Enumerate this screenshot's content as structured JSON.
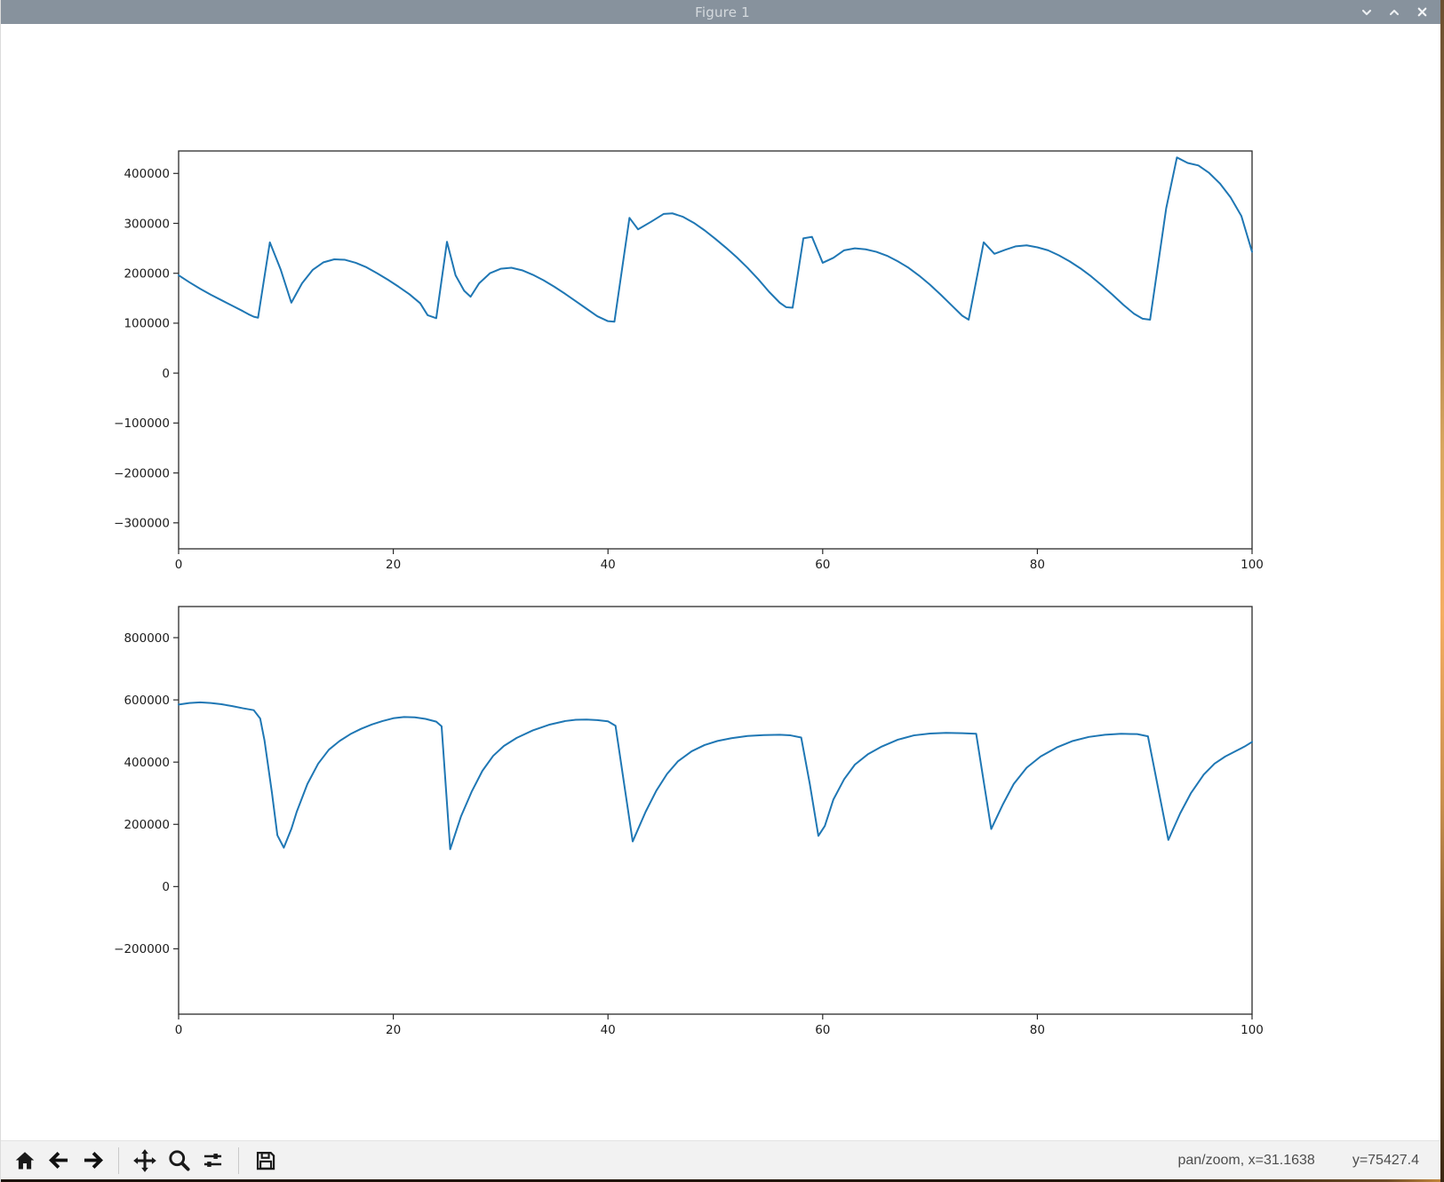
{
  "window": {
    "title": "Figure 1",
    "titlebar_color": "#87929d",
    "accent_color": "#f5ad62"
  },
  "titlebar_controls": {
    "minimize_icon": "chevron-down",
    "maximize_icon": "chevron-up",
    "close_icon": "x"
  },
  "toolbar": {
    "buttons": [
      {
        "icon": "home"
      },
      {
        "icon": "back-arrow"
      },
      {
        "icon": "forward-arrow"
      },
      {
        "icon": "pan-move"
      },
      {
        "icon": "zoom-magnifier"
      },
      {
        "icon": "subplot-sliders"
      },
      {
        "icon": "save-floppy"
      }
    ],
    "status_left": "pan/zoom, x=31.1638",
    "status_right": "y=75427.4"
  },
  "chart_data": [
    {
      "type": "line",
      "color": "#1f77b4",
      "line_width": 2,
      "axis_color": "#2b2b2b",
      "grid": false,
      "legend": null,
      "xlim": [
        0,
        100
      ],
      "ylim": [
        -352000,
        445000
      ],
      "xticks": {
        "values": [
          0,
          20,
          40,
          60,
          80,
          100
        ],
        "labels": [
          "0",
          "20",
          "40",
          "60",
          "80",
          "100"
        ]
      },
      "yticks": {
        "values": [
          400000,
          300000,
          200000,
          100000,
          0,
          -100000,
          -200000,
          -300000
        ],
        "labels": [
          "400000",
          "300000",
          "200000",
          "100000",
          "0",
          "−100000",
          "−200000",
          "−300000"
        ]
      },
      "points": [
        [
          0,
          196000
        ],
        [
          1,
          182000
        ],
        [
          2,
          169000
        ],
        [
          3,
          157000
        ],
        [
          4,
          146000
        ],
        [
          5,
          135000
        ],
        [
          6,
          124000
        ],
        [
          6.5,
          118000
        ],
        [
          7,
          113000
        ],
        [
          7.4,
          111000
        ],
        [
          8.5,
          262000
        ],
        [
          9.5,
          208000
        ],
        [
          10.5,
          141000
        ],
        [
          11.5,
          180000
        ],
        [
          12.5,
          207000
        ],
        [
          13.5,
          222000
        ],
        [
          14.5,
          228000
        ],
        [
          15.5,
          227000
        ],
        [
          16.5,
          221000
        ],
        [
          17.5,
          212000
        ],
        [
          18.5,
          200000
        ],
        [
          19.5,
          187000
        ],
        [
          20.5,
          173000
        ],
        [
          21.5,
          158000
        ],
        [
          22.5,
          140000
        ],
        [
          23.2,
          116000
        ],
        [
          24,
          110000
        ],
        [
          25,
          263000
        ],
        [
          25.8,
          196000
        ],
        [
          26.6,
          165000
        ],
        [
          27.2,
          153000
        ],
        [
          28,
          180000
        ],
        [
          29,
          200000
        ],
        [
          30,
          209000
        ],
        [
          31,
          211000
        ],
        [
          32,
          206000
        ],
        [
          33,
          197000
        ],
        [
          34,
          186000
        ],
        [
          35,
          173000
        ],
        [
          36,
          159000
        ],
        [
          37,
          144000
        ],
        [
          38,
          129000
        ],
        [
          39,
          114000
        ],
        [
          40,
          104000
        ],
        [
          40.6,
          103000
        ],
        [
          42,
          311000
        ],
        [
          42.8,
          288000
        ],
        [
          44,
          303000
        ],
        [
          45.2,
          319000
        ],
        [
          46,
          320000
        ],
        [
          47,
          313000
        ],
        [
          48,
          301000
        ],
        [
          49,
          286000
        ],
        [
          50,
          269000
        ],
        [
          51,
          251000
        ],
        [
          52,
          232000
        ],
        [
          53,
          211000
        ],
        [
          54,
          188000
        ],
        [
          55,
          163000
        ],
        [
          56,
          141000
        ],
        [
          56.6,
          132000
        ],
        [
          57.2,
          131000
        ],
        [
          58.2,
          270000
        ],
        [
          59,
          273000
        ],
        [
          60,
          221000
        ],
        [
          61,
          231000
        ],
        [
          62,
          246000
        ],
        [
          63,
          250000
        ],
        [
          64,
          248000
        ],
        [
          65,
          243000
        ],
        [
          66,
          235000
        ],
        [
          67,
          224000
        ],
        [
          68,
          211000
        ],
        [
          69,
          195000
        ],
        [
          70,
          177000
        ],
        [
          71,
          157000
        ],
        [
          72,
          136000
        ],
        [
          73,
          115000
        ],
        [
          73.6,
          107000
        ],
        [
          75,
          262000
        ],
        [
          76,
          239000
        ],
        [
          77,
          247000
        ],
        [
          78,
          254000
        ],
        [
          79,
          256000
        ],
        [
          80,
          252000
        ],
        [
          81,
          246000
        ],
        [
          82,
          236000
        ],
        [
          83,
          224000
        ],
        [
          84,
          210000
        ],
        [
          85,
          194000
        ],
        [
          86,
          176000
        ],
        [
          87,
          157000
        ],
        [
          88,
          137000
        ],
        [
          89,
          119000
        ],
        [
          89.8,
          109000
        ],
        [
          90.5,
          107000
        ],
        [
          92,
          330000
        ],
        [
          93,
          432000
        ],
        [
          94,
          421000
        ],
        [
          95,
          416000
        ],
        [
          96,
          401000
        ],
        [
          97,
          380000
        ],
        [
          98,
          352000
        ],
        [
          99,
          315000
        ],
        [
          100,
          243000
        ]
      ]
    },
    {
      "type": "line",
      "color": "#1f77b4",
      "line_width": 2,
      "axis_color": "#2b2b2b",
      "grid": false,
      "legend": null,
      "xlim": [
        0,
        100
      ],
      "ylim": [
        -410000,
        900000
      ],
      "xticks": {
        "values": [
          0,
          20,
          40,
          60,
          80,
          100
        ],
        "labels": [
          "0",
          "20",
          "40",
          "60",
          "80",
          "100"
        ]
      },
      "yticks": {
        "values": [
          800000,
          600000,
          400000,
          200000,
          0,
          -200000
        ],
        "labels": [
          "800000",
          "600000",
          "400000",
          "200000",
          "0",
          "−200000"
        ]
      },
      "points": [
        [
          0,
          585000
        ],
        [
          1,
          590000
        ],
        [
          2,
          592000
        ],
        [
          3,
          590000
        ],
        [
          4,
          586000
        ],
        [
          5,
          580000
        ],
        [
          6,
          573000
        ],
        [
          7,
          567000
        ],
        [
          7.6,
          540000
        ],
        [
          8,
          470000
        ],
        [
          8.7,
          300000
        ],
        [
          9.2,
          165000
        ],
        [
          9.8,
          125000
        ],
        [
          10.5,
          185000
        ],
        [
          11,
          240000
        ],
        [
          12,
          330000
        ],
        [
          13,
          395000
        ],
        [
          14,
          440000
        ],
        [
          15,
          468000
        ],
        [
          16,
          490000
        ],
        [
          17,
          507000
        ],
        [
          18,
          521000
        ],
        [
          19,
          532000
        ],
        [
          20,
          541000
        ],
        [
          21,
          545000
        ],
        [
          22,
          544000
        ],
        [
          23,
          539000
        ],
        [
          24,
          530000
        ],
        [
          24.5,
          515000
        ],
        [
          25.3,
          120000
        ],
        [
          26.3,
          225000
        ],
        [
          27.3,
          305000
        ],
        [
          28.3,
          372000
        ],
        [
          29.3,
          420000
        ],
        [
          30.3,
          452000
        ],
        [
          31.5,
          478000
        ],
        [
          33,
          502000
        ],
        [
          34.5,
          520000
        ],
        [
          36,
          532000
        ],
        [
          37,
          536000
        ],
        [
          38,
          537000
        ],
        [
          39,
          535000
        ],
        [
          40,
          531000
        ],
        [
          40.7,
          517000
        ],
        [
          42.3,
          145000
        ],
        [
          43.5,
          240000
        ],
        [
          44.5,
          308000
        ],
        [
          45.5,
          362000
        ],
        [
          46.5,
          402000
        ],
        [
          47.8,
          435000
        ],
        [
          49,
          455000
        ],
        [
          50.2,
          468000
        ],
        [
          51.5,
          477000
        ],
        [
          53,
          484000
        ],
        [
          54.5,
          487000
        ],
        [
          56,
          488000
        ],
        [
          57,
          486000
        ],
        [
          58,
          479000
        ],
        [
          58.8,
          330000
        ],
        [
          59.6,
          163000
        ],
        [
          60.2,
          195000
        ],
        [
          61,
          280000
        ],
        [
          62,
          345000
        ],
        [
          63,
          392000
        ],
        [
          64.2,
          425000
        ],
        [
          65.5,
          450000
        ],
        [
          67,
          472000
        ],
        [
          68.5,
          486000
        ],
        [
          70,
          492000
        ],
        [
          71.5,
          494000
        ],
        [
          73,
          493000
        ],
        [
          74.3,
          491000
        ],
        [
          75.7,
          185000
        ],
        [
          76.8,
          265000
        ],
        [
          77.8,
          330000
        ],
        [
          79,
          382000
        ],
        [
          80.3,
          418000
        ],
        [
          81.8,
          447000
        ],
        [
          83.3,
          468000
        ],
        [
          84.8,
          481000
        ],
        [
          86.3,
          488000
        ],
        [
          87.8,
          491000
        ],
        [
          89.3,
          490000
        ],
        [
          90.3,
          483000
        ],
        [
          92.2,
          150000
        ],
        [
          93.3,
          235000
        ],
        [
          94.3,
          300000
        ],
        [
          95.5,
          360000
        ],
        [
          96.5,
          395000
        ],
        [
          97.5,
          418000
        ],
        [
          98.5,
          436000
        ],
        [
          99.3,
          450000
        ],
        [
          100,
          465000
        ]
      ]
    }
  ]
}
